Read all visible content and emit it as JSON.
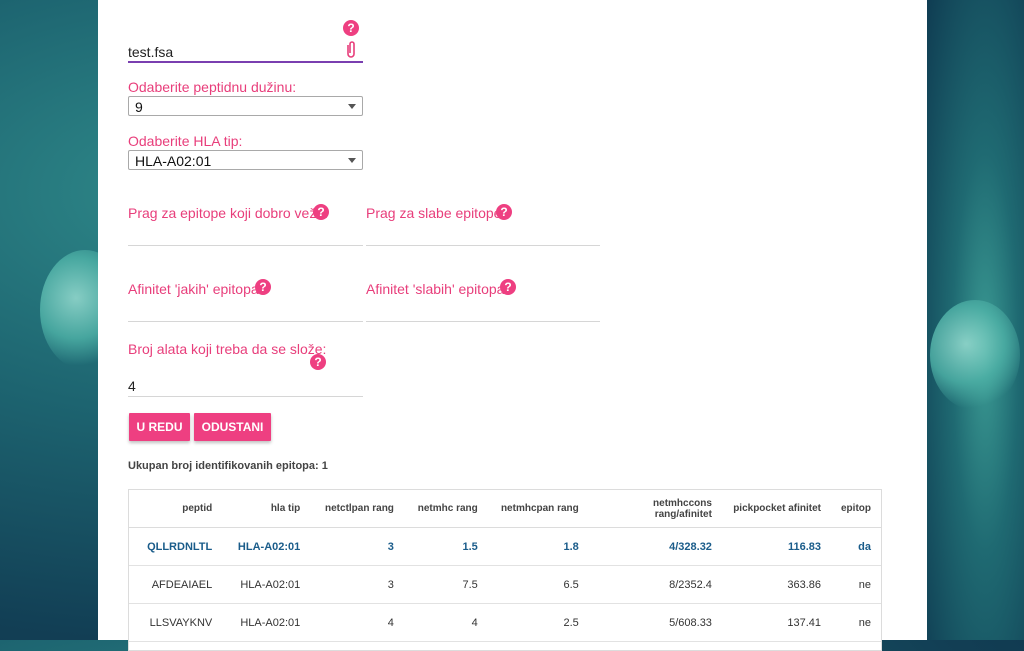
{
  "file": {
    "value": "test.fsa"
  },
  "peptide_length": {
    "label": "Odaberite peptidnu dužinu:",
    "value": "9"
  },
  "hla_type": {
    "label": "Odaberite HLA tip:",
    "value": "HLA-A02:01"
  },
  "thresholds": {
    "strong_label": "Prag za epitope koji dobro vežu:",
    "weak_label": "Prag za slabe epitope:",
    "strong_affinity_label": "Afinitet 'jakih' epitopa:",
    "weak_affinity_label": "Afinitet 'slabih' epitopa:"
  },
  "tools": {
    "label": "Broj alata koji treba da se slože:",
    "value": "4"
  },
  "buttons": {
    "ok": "U REDU",
    "cancel": "ODUSTANI"
  },
  "help_glyph": "?",
  "summary": "Ukupan broj identifikovanih epitopa: 1",
  "table": {
    "headers": [
      "peptid",
      "hla tip",
      "netctlpan rang",
      "netmhc rang",
      "netmhcpan rang",
      "netmhccons rang/afinitet",
      "pickpocket afinitet",
      "epitop"
    ],
    "rows": [
      [
        "QLLRDNLTL",
        "HLA-A02:01",
        "3",
        "1.5",
        "1.8",
        "4/328.32",
        "116.83",
        "da"
      ],
      [
        "AFDEAIAEL",
        "HLA-A02:01",
        "3",
        "7.5",
        "6.5",
        "8/2352.4",
        "363.86",
        "ne"
      ],
      [
        "LLSVAYKNV",
        "HLA-A02:01",
        "4",
        "4",
        "2.5",
        "5/608.33",
        "137.41",
        "ne"
      ]
    ]
  },
  "colors": {
    "accent": "#ee3f81",
    "highlight_row": "#1a5c8a"
  }
}
